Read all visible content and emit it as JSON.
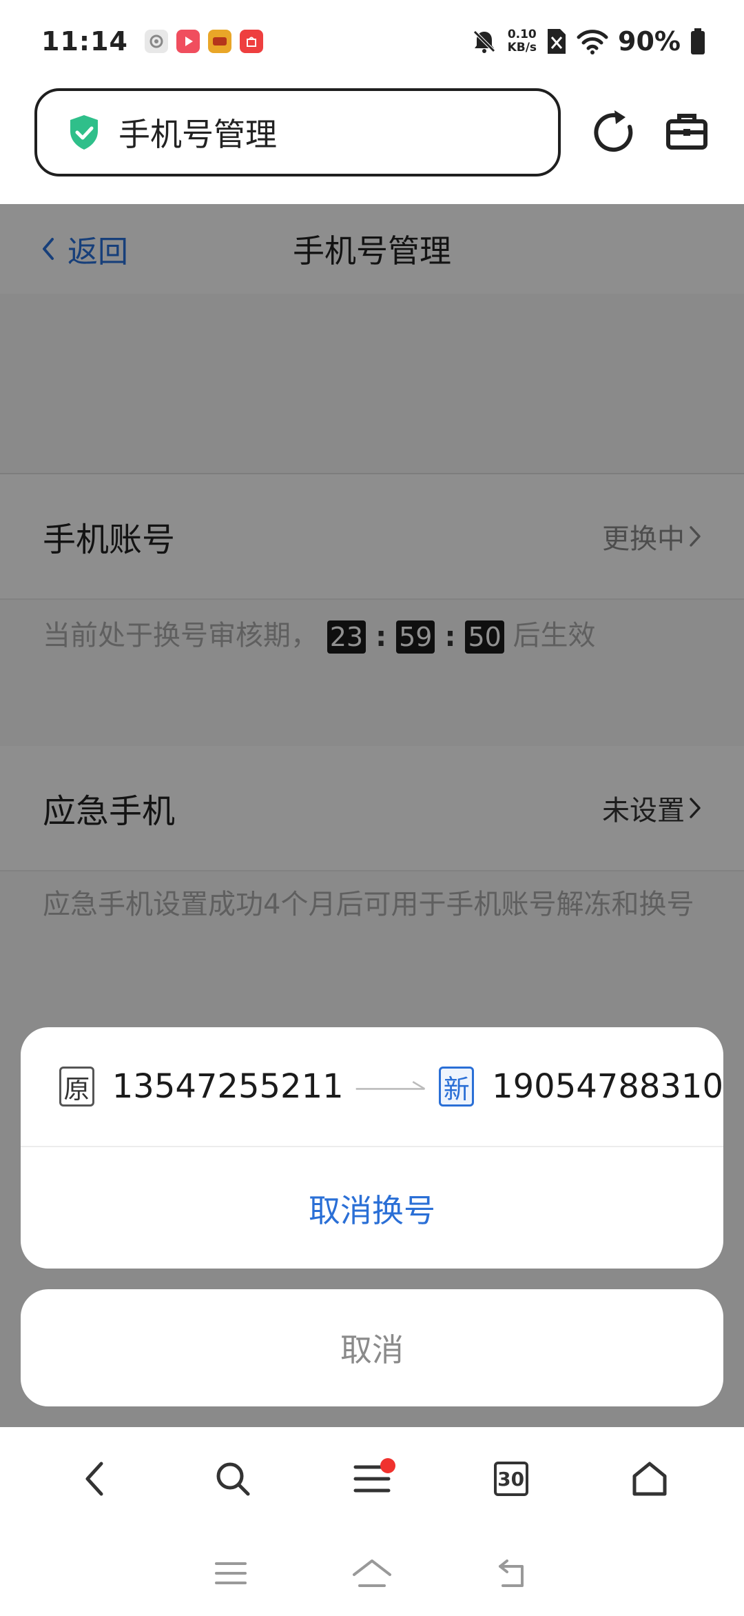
{
  "status_bar": {
    "time": "11:14",
    "net_speed_value": "0.10",
    "net_speed_unit": "KB/s",
    "battery": "90%"
  },
  "browser": {
    "url_title": "手机号管理"
  },
  "page": {
    "back_label": "返回",
    "title": "手机号管理",
    "phone_account": {
      "label": "手机账号",
      "value": "更换中"
    },
    "review_note": {
      "prefix": "当前处于换号审核期，",
      "hours": "23",
      "minutes": "59",
      "seconds": "50",
      "suffix": "后生效"
    },
    "emergency_phone": {
      "label": "应急手机",
      "value": "未设置"
    },
    "emergency_note": "应急手机设置成功4个月后可用于手机账号解冻和换号"
  },
  "action_sheet": {
    "old_tag": "原",
    "old_number": "13547255211",
    "new_tag": "新",
    "new_number": "19054788310",
    "cancel_change_label": "取消换号",
    "cancel_label": "取消"
  },
  "toolbar": {
    "tab_count": "30"
  },
  "colors": {
    "accent": "#2a6fd6",
    "shield": "#2fbf8a",
    "notification_dot": "#f0322e"
  }
}
